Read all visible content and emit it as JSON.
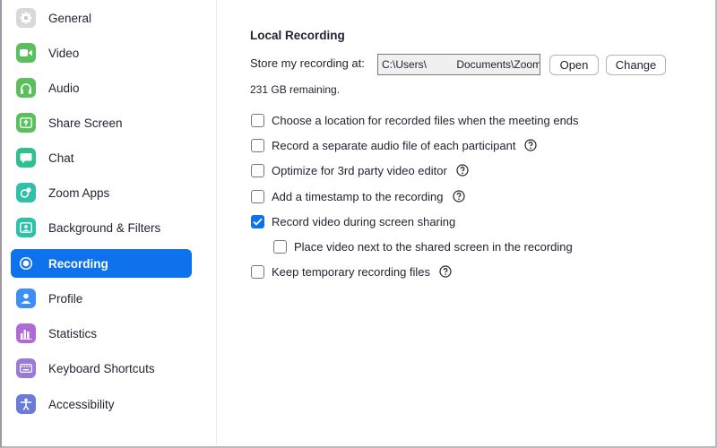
{
  "sidebar": {
    "items": [
      {
        "label": "General",
        "icon": "gear-icon",
        "color": "#b5b5b5"
      },
      {
        "label": "Video",
        "icon": "video-camera-icon",
        "color": "#4caf50"
      },
      {
        "label": "Audio",
        "icon": "headphones-icon",
        "color": "#4caf50"
      },
      {
        "label": "Share Screen",
        "icon": "share-screen-icon",
        "color": "#4caf50"
      },
      {
        "label": "Chat",
        "icon": "chat-bubble-icon",
        "color": "#21b88a"
      },
      {
        "label": "Zoom Apps",
        "icon": "apps-icon",
        "color": "#21b8a0"
      },
      {
        "label": "Background & Filters",
        "icon": "background-icon",
        "color": "#21b8a0"
      },
      {
        "label": "Recording",
        "icon": "recording-icon",
        "color": "#ffffff",
        "active": true
      },
      {
        "label": "Profile",
        "icon": "profile-icon",
        "color": "#3d8ef5"
      },
      {
        "label": "Statistics",
        "icon": "statistics-icon",
        "color": "#b06ad8"
      },
      {
        "label": "Keyboard Shortcuts",
        "icon": "keyboard-icon",
        "color": "#9a7ad8"
      },
      {
        "label": "Accessibility",
        "icon": "accessibility-icon",
        "color": "#6b7bd8"
      }
    ]
  },
  "main": {
    "section_title": "Local Recording",
    "store_label": "Store my recording at:",
    "path_value": "C:\\Users\\          Documents\\Zoom",
    "open_label": "Open",
    "change_label": "Change",
    "remaining": "231 GB remaining.",
    "options": [
      {
        "label": "Choose a location for recorded files when the meeting ends",
        "checked": false,
        "help": false,
        "indent": false
      },
      {
        "label": "Record a separate audio file of each participant",
        "checked": false,
        "help": true,
        "indent": false
      },
      {
        "label": "Optimize for 3rd party video editor",
        "checked": false,
        "help": true,
        "indent": false
      },
      {
        "label": "Add a timestamp to the recording",
        "checked": false,
        "help": true,
        "indent": false
      },
      {
        "label": "Record video during screen sharing",
        "checked": true,
        "help": false,
        "indent": false
      },
      {
        "label": "Place video next to the shared screen in the recording",
        "checked": false,
        "help": false,
        "indent": true
      },
      {
        "label": "Keep temporary recording files",
        "checked": false,
        "help": true,
        "indent": false
      }
    ]
  },
  "colors": {
    "accent": "#0e72ed",
    "text": "#232333"
  }
}
